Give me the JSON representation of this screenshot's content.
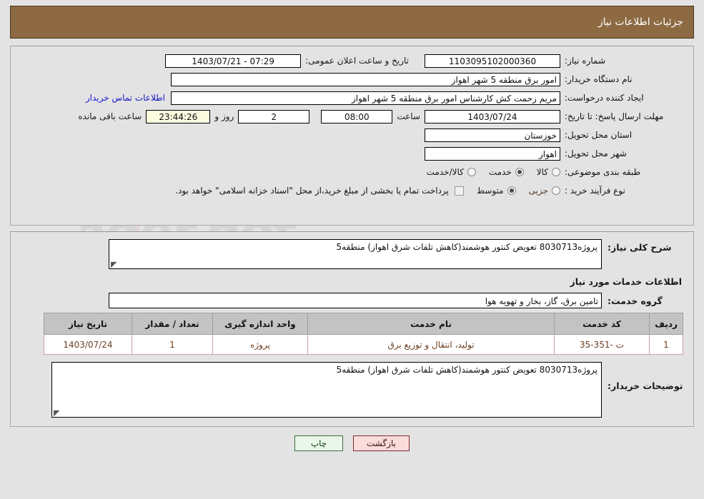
{
  "header": {
    "title": "جزئیات اطلاعات نیاز"
  },
  "form": {
    "need_number_label": "شماره نیاز:",
    "need_number_value": "1103095102000360",
    "announce_label": "تاریخ و ساعت اعلان عمومی:",
    "announce_value": "07:29 - 1403/07/21",
    "buyer_org_label": "نام دستگاه خریدار:",
    "buyer_org_value": "امور برق منطقه 5 شهر اهواز",
    "creator_label": "ایجاد کننده درخواست:",
    "creator_value": "مریم زحمت کش کارشناس امور برق منطقه 5 شهر اهواز",
    "contact_link": "اطلاعات تماس خریدار",
    "deadline_label": "مهلت ارسال پاسخ: تا تاریخ:",
    "deadline_date": "1403/07/24",
    "hour_label": "ساعت",
    "deadline_time": "08:00",
    "days_value": "2",
    "days_label": "روز و",
    "countdown_value": "23:44:26",
    "countdown_label": "ساعت باقی مانده",
    "province_label": "استان محل تحویل:",
    "province_value": "خوزستان",
    "city_label": "شهر محل تحویل:",
    "city_value": "اهواز",
    "category_label": "طبقه بندی موضوعی:",
    "category_options": [
      {
        "label": "کالا",
        "selected": false
      },
      {
        "label": "خدمت",
        "selected": true
      },
      {
        "label": "کالا/خدمت",
        "selected": false
      }
    ],
    "process_label": "نوع فرآیند خرید :",
    "process_options": [
      {
        "label": "جزیی",
        "selected": false
      },
      {
        "label": "متوسط",
        "selected": true
      }
    ],
    "treasury_checkbox_note": "پرداخت تمام یا بخشی از مبلغ خرید،از محل \"اسناد خزانه اسلامی\" خواهد بود."
  },
  "description": {
    "general_label": "شرح کلی نیاز:",
    "general_value": "پروژه8030713 تعویض کنتور هوشمند(کاهش تلفات شرق اهواز) منطقه5",
    "services_section_title": "اطلاعات خدمات مورد نیاز",
    "service_group_label": "گروه خدمت:",
    "service_group_value": "تامین برق، گاز، بخار و تهویه هوا"
  },
  "table": {
    "columns": [
      "ردیف",
      "کد خدمت",
      "نام خدمت",
      "واحد اندازه گیری",
      "تعداد / مقدار",
      "تاریخ نیاز"
    ],
    "rows": [
      [
        "1",
        "ت -351-35",
        "تولید، انتقال و توزیع برق",
        "پروژه",
        "1",
        "1403/07/24"
      ]
    ]
  },
  "buyer_notes": {
    "label": "توضیحات خریدار:",
    "value": "پروژه8030713 تعویض کنتور هوشمند(کاهش تلفات شرق اهواز) منطقه5"
  },
  "footer": {
    "print_label": "چاپ",
    "back_label": "بازگشت"
  },
  "watermark": {
    "text": "AriaTender.net"
  }
}
